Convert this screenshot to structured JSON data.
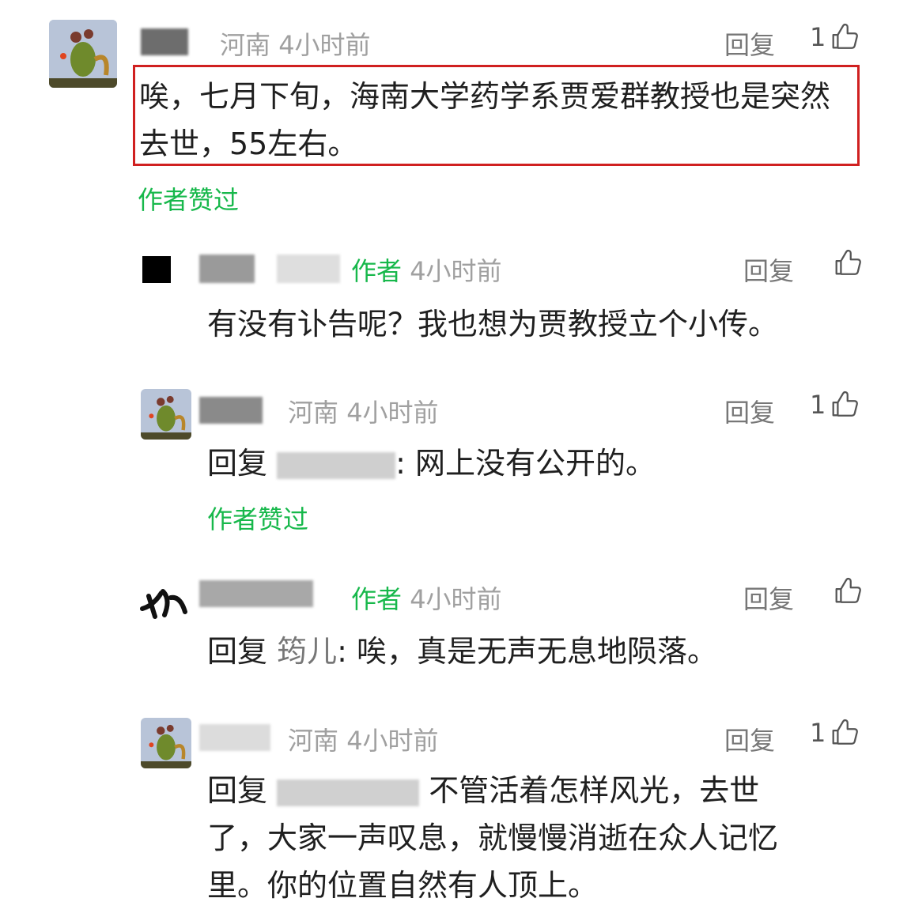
{
  "comments": [
    {
      "location": "河南",
      "time": "4小时前",
      "reply_label": "回复",
      "likes": "1",
      "text": "唉，七月下旬，海南大学药学系贾爱群教授也是突然去世，55左右。",
      "liked_by_author": "作者赞过"
    },
    {
      "author_tag": "作者",
      "time": "4小时前",
      "reply_label": "回复",
      "text": "有没有讣告呢？我也想为贾教授立个小传。"
    },
    {
      "location": "河南",
      "time": "4小时前",
      "reply_label": "回复",
      "likes": "1",
      "reply_prefix": "回复",
      "text": ": 网上没有公开的。",
      "liked_by_author": "作者赞过"
    },
    {
      "author_tag": "作者",
      "time": "4小时前",
      "reply_label": "回复",
      "reply_prefix": "回复",
      "reply_target": "筠儿",
      "text": ": 唉，真是无声无息地陨落。"
    },
    {
      "location": "河南",
      "time": "4小时前",
      "reply_label": "回复",
      "likes": "1",
      "reply_prefix": "回复",
      "text_line1": "不管活着怎样风光，去世",
      "text_line2": "了，大家一声叹息，就慢慢消逝在众人记忆",
      "text_line3": "里。你的位置自然有人顶上。"
    }
  ],
  "colors": {
    "accent_green": "#17b84b",
    "highlight_red": "#d02020",
    "meta_gray": "#a0a0a0"
  },
  "icons": [
    "thumbs-up-icon",
    "avatar-image"
  ]
}
